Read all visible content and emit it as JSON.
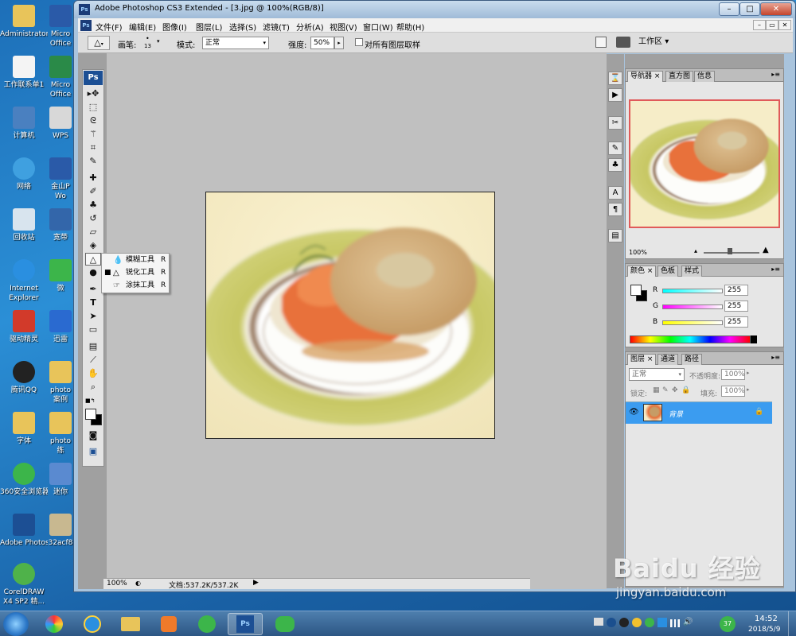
{
  "window": {
    "title": "Adobe Photoshop CS3 Extended - [3.jpg @ 100%(RGB/8)]",
    "logo": "Ps"
  },
  "menu": {
    "items": [
      "文件(F)",
      "编辑(E)",
      "图像(I)",
      "图层(L)",
      "选择(S)",
      "滤镜(T)",
      "分析(A)",
      "视图(V)",
      "窗口(W)",
      "帮助(H)"
    ]
  },
  "options": {
    "brush_label": "画笔:",
    "brush_size": "13",
    "mode_label": "模式:",
    "mode_value": "正常",
    "strength_label": "强度:",
    "strength_value": "50%",
    "sample_all_label": "对所有图层取样",
    "workspace_label": "工作区"
  },
  "toolbox": {
    "badge": "Ps"
  },
  "flyout": {
    "items": [
      {
        "label": "模糊工具",
        "key": "R",
        "selected": false
      },
      {
        "label": "锐化工具",
        "key": "R",
        "selected": true
      },
      {
        "label": "涂抹工具",
        "key": "R",
        "selected": false
      }
    ]
  },
  "status": {
    "zoom": "100%",
    "doc_info": "文档:537.2K/537.2K"
  },
  "navigator": {
    "tabs": [
      "导航器",
      "直方图",
      "信息"
    ],
    "zoom": "100%"
  },
  "color_panel": {
    "tabs": [
      "颜色",
      "色板",
      "样式"
    ],
    "r_label": "R",
    "g_label": "G",
    "b_label": "B",
    "r_value": "255",
    "g_value": "255",
    "b_value": "255"
  },
  "layers_panel": {
    "tabs": [
      "图层",
      "通道",
      "路径"
    ],
    "blend_mode": "正常",
    "opacity_label": "不透明度:",
    "opacity_value": "100%",
    "lock_label": "锁定:",
    "fill_label": "填充:",
    "fill_value": "100%",
    "layer_name": "背景"
  },
  "desktop": {
    "icons_col1": [
      "Administrator",
      "工作联系单1",
      "计算机",
      "网络",
      "回收站",
      "Internet Explorer",
      "驱动精灵",
      "腾讯QQ",
      "字体",
      "360安全浏览器",
      "Adobe Photosh...",
      "CorelDRAW X4 SP2 精..."
    ],
    "icons_col2": [
      "Micro Office",
      "Micro Office",
      "WPS",
      "金山P Wo",
      "宽带",
      "微",
      "迅雷",
      "photo 案例",
      "photo 练",
      "迷你",
      "32acf8"
    ]
  },
  "taskbar": {
    "time": "14:52",
    "date": "2018/5/9",
    "badge": "37"
  },
  "watermark": {
    "brand": "Baidu 经验",
    "url": "jingyan.baidu.com"
  },
  "colors": {
    "accent": "#3b9cf0",
    "brush_preview_red": "#e05a5a"
  }
}
